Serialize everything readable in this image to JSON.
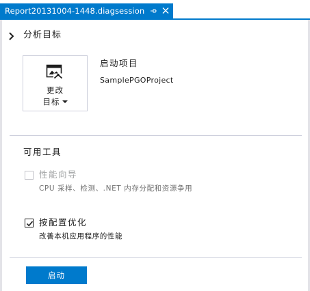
{
  "tab": {
    "title": "Report20131004-1448.diagsession",
    "pin_icon": "pin-icon",
    "close_icon": "close-icon"
  },
  "analysis_target": {
    "header": "分析目标",
    "change_target_line1": "更改",
    "change_target_line2": "目标",
    "startup_title": "启动项目",
    "startup_project": "SamplePGOProject"
  },
  "tools": {
    "header": "可用工具",
    "items": [
      {
        "label": "性能向导",
        "description": "CPU 采样、检测、.NET 内存分配和资源争用",
        "checked": false,
        "enabled": false
      },
      {
        "label": "按配置优化",
        "description": "改善本机应用程序的性能",
        "checked": true,
        "enabled": true
      }
    ]
  },
  "start_button": "启动",
  "colors": {
    "accent": "#007acc",
    "border": "#cccedb",
    "disabled_text": "#a2a4a5"
  }
}
